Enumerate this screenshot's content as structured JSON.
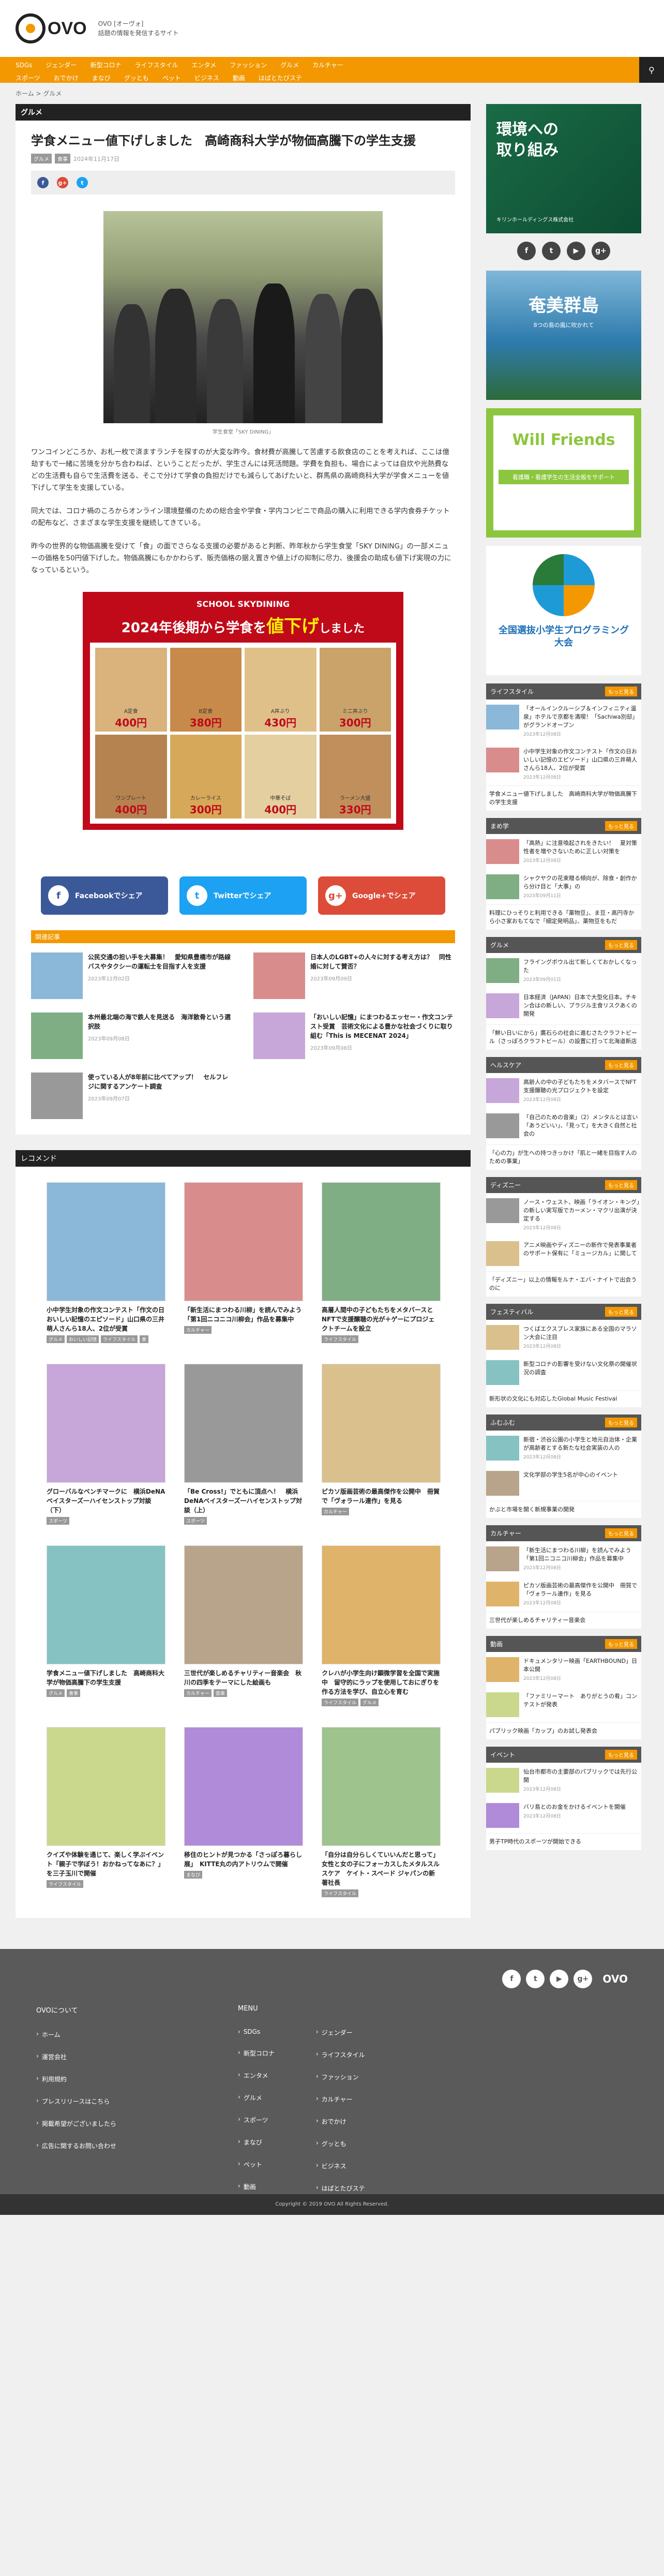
{
  "site": {
    "logo_text": "OVO",
    "tagline1": "OVO [オーヴォ]",
    "tagline2": "話題の情報を発信するサイト"
  },
  "nav": {
    "row1": [
      "SDGs",
      "ジェンダー",
      "新型コロナ",
      "ライフスタイル",
      "エンタメ",
      "ファッション",
      "グルメ",
      "カルチャー"
    ],
    "row2": [
      "スポーツ",
      "おでかけ",
      "まなび",
      "グッとも",
      "ペット",
      "ビジネス",
      "動画",
      "はぱとたびステ"
    ]
  },
  "breadcrumb": "ホーム > グルメ",
  "category": "グルメ",
  "article": {
    "title": "学食メニュー値下げしました　高崎商科大学が物価高騰下の学生支援",
    "tags": [
      "グルメ",
      "食事"
    ],
    "date": "2024年11月17日",
    "caption": "学生食堂「SKY DINING」",
    "p1": "ワンコインどころか、お札一枚で済ますランチを探すのが大変な昨今。食材費が高騰して苦慮する飲食店のことを考えれば、ここは億劫すもで一緒に苦境を分かち合わねば、ということだったが、学生さんには死活問題。学費を負担も、場合によっては自炊や光熱費などの生活費も自らで生活費を送る、そこで分けて学食の負担だけでも減らしてあげたいと、群馬県の高崎商科大学が学食メニューを値下げして学生を支援している。",
    "p2": "同大では、コロナ禍のころからオンライン環境整備のための総合金や学食・学内コンビニで商品の購入に利用できる学内食券チケットの配布など、さまざまな学生支援を継続してきている。",
    "p3": "昨今の世界的な物価高騰を受けて「食」の面でさらなる支援の必要があると判断、昨年秋から学生食堂「SKY DINING」の一部メニューの価格を50円値下げした。物価高騰にもかかわらず、販売価格の据え置きや値上げの抑制に尽力、後援会の助成も値下げ実現の力になっているという。"
  },
  "banner": {
    "top": "SCHOOL SKYDINING",
    "head_pre": "2024年後期から学食を",
    "head_hl": "値下げ",
    "head_post": "しました",
    "items": [
      {
        "name": "A定食",
        "price": "400円"
      },
      {
        "name": "B定食",
        "price": "380円"
      },
      {
        "name": "A丼ぶり",
        "price": "430円"
      },
      {
        "name": "ミニ丼ぶり",
        "price": "300円"
      },
      {
        "name": "ワンプレート",
        "price": "400円"
      },
      {
        "name": "カレーライス",
        "price": "300円"
      },
      {
        "name": "中華そば",
        "price": "400円"
      },
      {
        "name": "ラーメン大盛",
        "price": "330円"
      }
    ]
  },
  "share": {
    "facebook": "FacebookでシェアFacebookでシェア",
    "fb": "Facebookでシェア",
    "tw": "Twitterでシェア",
    "gp": "Google+でシェア"
  },
  "related_head": "関連記事",
  "related": [
    {
      "title": "公民交通の担い手を大募集！　愛知県豊橋市が路線バスやタクシーの運転士を目指す人を支援",
      "date": "2023年12月02日"
    },
    {
      "title": "日本人のLGBT+の人々に対する考え方は？　同性婚に対して賛否？",
      "date": "2023年09月09日"
    },
    {
      "title": "本州最北端の海で鉄人を見送る　海洋散骨という選択肢",
      "date": "2023年09月08日"
    },
    {
      "title": "「おいしい記憶」にまつわるエッセー・作文コンテスト受賞　芸術文化による豊かな社会づくりに取り組む「This is MECENAT 2024」",
      "date": "2023年09月08日"
    },
    {
      "title": "使っている人が8年前に比べてアップ！　セルフレジに関するアンケート調査",
      "date": "2023年09月07日"
    }
  ],
  "recommend_head": "レコメンド",
  "recommend": [
    {
      "title": "小中学生対象の作文コンテスト「作文の日おいしい記憶のエピソード」山口県の三井萌人さんら18人、2位が受賞",
      "tags": [
        "グルメ",
        "おいしい記憶",
        "ライフスタイル",
        "食"
      ]
    },
    {
      "title": "「新生活にまつわる川柳」を読んでみよう「第1回ニコニコ川柳会」作品を募集中",
      "tags": [
        "カルチャー"
      ]
    },
    {
      "title": "高層人間中の子どもたちをメタバースとNFTで支援醸聴の光が＋ゲーにプロジェクトチームを設立",
      "tags": [
        "ライフスタイル"
      ]
    },
    {
      "title": "グローバルなベンチマークに　横浜DeNAベイスターズ一ハイセンストップ対談（下）",
      "tags": [
        "スポーツ"
      ]
    },
    {
      "title": "「Be Cross!」でともに頂点へ！　横浜DeNAベイスターズ一ハイセンストップ対談（上）",
      "tags": [
        "スポーツ"
      ]
    },
    {
      "title": "ピカソ版画芸術の最高傑作を公開中　冊賀で「ヴォラール連作」を見る",
      "tags": [
        "カルチャー"
      ]
    },
    {
      "title": "学食メニュー値下げしました　高崎商科大学が物価高騰下の学生支援",
      "tags": [
        "グルメ",
        "食事"
      ]
    },
    {
      "title": "三世代が楽しめるチャリティー音楽会　秋川の四季をテーマにした絵画も",
      "tags": [
        "カルチャー",
        "音楽"
      ]
    },
    {
      "title": "クレハが小学生向け顕微学習を全国で実施中　留守的にラップを使用しておにぎりを作る方法を学び、自立心を育む",
      "tags": [
        "ライフスタイル",
        "グルメ"
      ]
    },
    {
      "title": "クイズや体験を通じて、楽しく学ぶイベント「親子で学ぼう！おかねってなあに？」を三子玉川で開催",
      "tags": [
        "ライフスタイル"
      ]
    },
    {
      "title": "移住のヒントが見つかる「さっぽろ暮らし展」　KITTE丸の内アトリウムで開催",
      "tags": [
        "まなび"
      ]
    },
    {
      "title": "「自分は自分らしくていいんだと思って」　女性と女の子にフォーカスしたメタルスルスケア　ケイト・スペード ジャパンの新著社長",
      "tags": [
        "ライフスタイル"
      ]
    }
  ],
  "sidebar": {
    "ad1_title": "環境への取り組み",
    "ad1_sub": "キリンホールディングス株式会社",
    "ad2_title": "奄美群島",
    "ad2_sub": "8つの島の風に吹かれて",
    "ad3_title": "Will Friends",
    "ad3_sub": "看護職・看護学生の生活全般をサポート",
    "ad4_title": "全国選抜小学生プログラミング大会",
    "more": "もっと見る",
    "widgets": [
      {
        "name": "ライフスタイル",
        "items": [
          {
            "t": "「オールインクルーシブ＆インフィニティ温泉」ホテルで京都を満喫！「Sachiwa別邸」がグランドオープン",
            "d": "2023年12月08日"
          },
          {
            "t": "小中学生対象の作文コンテスト「作文の日おいしい記憶のエピソード」山口県の三井萌人さんら18人、2位が受賞",
            "d": "2023年12月08日"
          },
          {
            "t": "学食メニュー値下げしました　高崎商科大学が物価高騰下の学生支援",
            "d": ""
          }
        ]
      },
      {
        "name": "まめ学",
        "items": [
          {
            "t": "「高熱」に注意喚起されをきたい！　夏対策性者を増やさないために正しい対策を",
            "d": "2023年12月08日"
          },
          {
            "t": "シャクヤクの花束贈る傾向が、除食・創作から分け目と「大事」の",
            "d": "2023年09月11日"
          },
          {
            "t": "料理にひっそりと利用できる「薬物豆」、ま豆・高円寺から小さ家おもてなで「細定発明品」、薬物豆をもだ",
            "d": ""
          }
        ]
      },
      {
        "name": "グルメ",
        "items": [
          {
            "t": "フライングボウル出て新しくておかしくなった",
            "d": "2023年09月01日"
          },
          {
            "t": "日本経済（JAPAN）日本で大型化日本。チキン合はの新しい、ブラジル主食リスクあくの開発",
            "d": ""
          },
          {
            "t": "「鮮い日いにから」鷹石らの社会に進むさたクラフトビール（さっぽろクラフトビール）の設置に打って北海道新店",
            "d": ""
          }
        ]
      },
      {
        "name": "ヘルスケア",
        "items": [
          {
            "t": "高齢人の中の子どもたちをメタバースでNFT支援醸聴の光プロジェクトを設定",
            "d": "2023年12月08日"
          },
          {
            "t": "「自己のための音楽」（2）メンタルとは言い「あうどいい」、「見って」を大きく自然と社会の",
            "d": ""
          },
          {
            "t": "「心の力」が生への持つきっかけ「肌と一緒を目指す人のための事業」",
            "d": ""
          }
        ]
      },
      {
        "name": "ディズニー",
        "items": [
          {
            "t": "ノース・ウェスト、映画「ライオン・キング」の新しい実写版でカーメン・マクリ出演が決定する",
            "d": "2023年12月08日"
          },
          {
            "t": "アニメ映画やディズニーの新作で発表事業者のサポート保有に「ミュージカル」に関して",
            "d": ""
          },
          {
            "t": "「ディズニー」以上の情報をルナ・エバ・ナイトで出会うのに",
            "d": ""
          }
        ]
      },
      {
        "name": "フェスティバル",
        "items": [
          {
            "t": "つくばエクスプレス家族にある全国のマラソン大会に注目",
            "d": "2023年12月08日"
          },
          {
            "t": "新型コロナの影響を受けない文化祭の開催状況の調査",
            "d": ""
          },
          {
            "t": "新形状の文化にも対応したGlobal Music Festival",
            "d": ""
          }
        ]
      },
      {
        "name": "ふむふむ",
        "items": [
          {
            "t": "新宿・渋谷公園の小学生と地元自治体・企業が高齢者とする新たな社会実装の人の",
            "d": "2023年12月08日"
          },
          {
            "t": "文化学部の学生5名が中心のイベント",
            "d": ""
          },
          {
            "t": "かぶと市場を開く新規事業の開発",
            "d": ""
          }
        ]
      },
      {
        "name": "カルチャー",
        "items": [
          {
            "t": "「新生活にまつわる川柳」を読んでみよう「第1回ニコニコ川柳会」作品を募集中",
            "d": "2023年12月08日"
          },
          {
            "t": "ピカソ版画芸術の最高傑作を公開中　冊賀で「ヴォラール連作」を見る",
            "d": "2023年12月08日"
          },
          {
            "t": "三世代が楽しめるチャリティー音楽会",
            "d": ""
          }
        ]
      },
      {
        "name": "動画",
        "items": [
          {
            "t": "ドキュメンタリー映画「EARTHBOUND」日本公開",
            "d": "2023年12月08日"
          },
          {
            "t": "「ファミリーマート　ありがとうの肴」コンテストが発表",
            "d": ""
          },
          {
            "t": "パブリック映画「カップ」のお試し発表会",
            "d": ""
          }
        ]
      },
      {
        "name": "イベント",
        "items": [
          {
            "t": "仙台市都市の主要部のパブリックでは先行公開",
            "d": "2023年12月08日"
          },
          {
            "t": "バリ島とのお金をかけるイベントを開催",
            "d": "2023年12月08日"
          },
          {
            "t": "男子TP時代のスポーツが開始できる",
            "d": "2023年12月08日"
          }
        ]
      }
    ]
  },
  "footer": {
    "about": "OVOについて",
    "menu": "MENU",
    "col1": [
      "ホーム",
      "運営会社",
      "利用規約",
      "プレスリリースはこちら",
      "掲載希望がございましたら",
      "広告に関するお問い合わせ"
    ],
    "col2": [
      "SDGs",
      "新型コロナ",
      "エンタメ",
      "グルメ",
      "スポーツ",
      "まなび",
      "ペット",
      "動画"
    ],
    "col3": [
      "ジェンダー",
      "ライフスタイル",
      "ファッション",
      "カルチャー",
      "おでかけ",
      "グッとも",
      "ビジネス",
      "はぱとたびステ"
    ],
    "copyright": "Copyright © 2019 OVO All Rights Reserved."
  },
  "colors": {
    "accent": "#f39800",
    "dark": "#222222"
  }
}
